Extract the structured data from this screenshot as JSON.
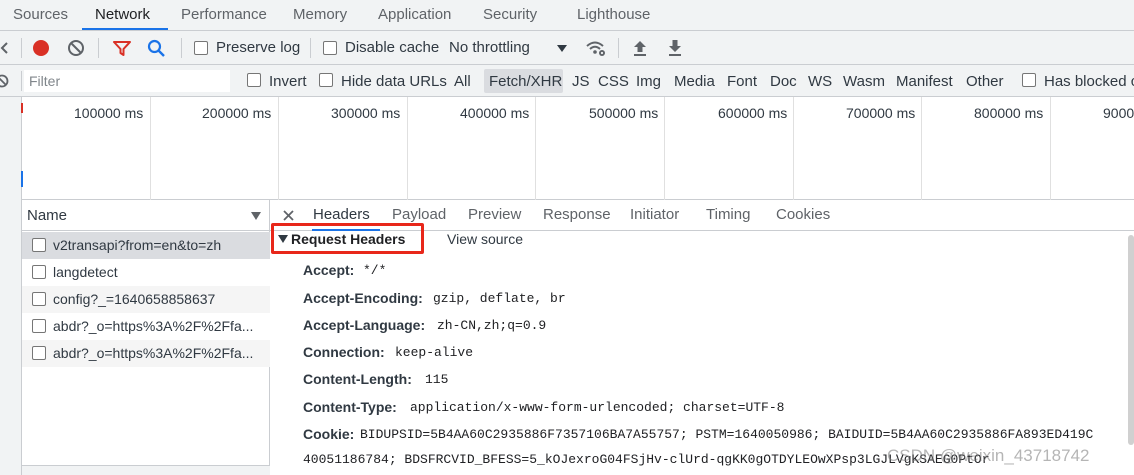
{
  "devtools_tabs": [
    "Sources",
    "Network",
    "Performance",
    "Memory",
    "Application",
    "Security",
    "Lighthouse"
  ],
  "toolbar": {
    "preserve_log": "Preserve log",
    "disable_cache": "Disable cache",
    "throttling": "No throttling"
  },
  "filter": {
    "placeholder": "Filter",
    "invert": "Invert",
    "hide_data_urls": "Hide data URLs",
    "types": [
      "All",
      "Fetch/XHR",
      "JS",
      "CSS",
      "Img",
      "Media",
      "Font",
      "Doc",
      "WS",
      "Wasm",
      "Manifest",
      "Other"
    ],
    "selected_type": "Fetch/XHR",
    "has_blocked": "Has blocked c"
  },
  "timeline_ticks": [
    "100000 ms",
    "200000 ms",
    "300000 ms",
    "400000 ms",
    "500000 ms",
    "600000 ms",
    "700000 ms",
    "800000 ms",
    "9000"
  ],
  "request_list": {
    "column": "Name",
    "rows": [
      "v2transapi?from=en&to=zh",
      "langdetect",
      "config?_=1640658858637",
      "abdr?_o=https%3A%2F%2Ffa...",
      "abdr?_o=https%3A%2F%2Ffa..."
    ],
    "selected_index": 0
  },
  "detail_tabs": [
    "Headers",
    "Payload",
    "Preview",
    "Response",
    "Initiator",
    "Timing",
    "Cookies"
  ],
  "request_headers": {
    "section_title": "Request Headers",
    "view_source": "View source",
    "items": [
      {
        "key": "Accept:",
        "value": "*/*"
      },
      {
        "key": "Accept-Encoding:",
        "value": "gzip, deflate, br"
      },
      {
        "key": "Accept-Language:",
        "value": "zh-CN,zh;q=0.9"
      },
      {
        "key": "Connection:",
        "value": "keep-alive"
      },
      {
        "key": "Content-Length:",
        "value": "115"
      },
      {
        "key": "Content-Type:",
        "value": "application/x-www-form-urlencoded; charset=UTF-8"
      },
      {
        "key": "Cookie:",
        "value": "BIDUPSID=5B4AA60C2935886F7357106BA7A55757; PSTM=1640050986; BAIDUID=5B4AA60C2935886FA893ED419C"
      }
    ],
    "cookie_continuation": "40051186784; BDSFRCVID_BFESS=5_kOJexroG04FSjHv-clUrd-qgKK0gOTDYLEOwXPsp3LGJLVgKSAEG0PtOr"
  },
  "watermark": "CSDN @weixin_43718742",
  "colors": {
    "accent": "#1a73e8",
    "record": "#d93025",
    "highlight_box": "#e8271a",
    "toolbar_bg": "#f1f3f4"
  }
}
